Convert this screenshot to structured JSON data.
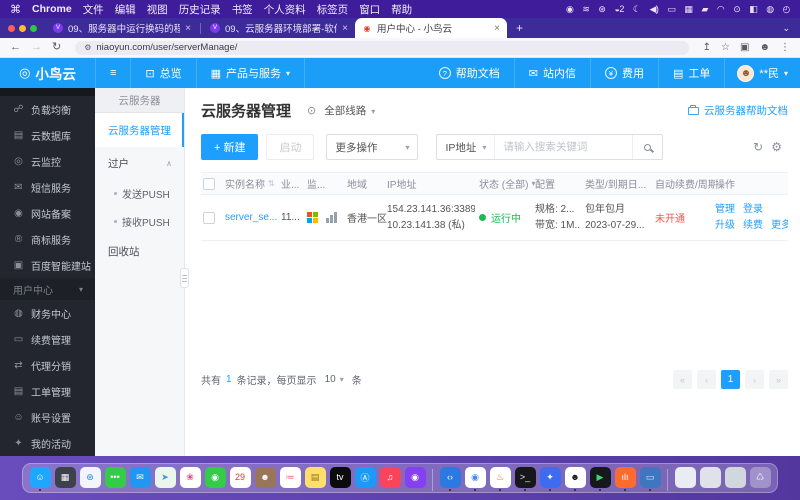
{
  "colors": {
    "accent": "#1e9fff",
    "status_green": "#1cba50",
    "alert_red": "#f0574d",
    "chrome_theme_purple": "#3f1d9a",
    "desktop_purple": "#5a3dab"
  },
  "menubar": {
    "apple": "⌘",
    "chrome": "Chrome",
    "items": [
      "文件",
      "编辑",
      "视图",
      "历史记录",
      "书签",
      "个人资料",
      "标签页",
      "窗口",
      "帮助"
    ],
    "status_icons": [
      {
        "name": "screen-record-icon",
        "glyph": "◉"
      },
      {
        "name": "audio-levels-icon",
        "glyph": "≋"
      },
      {
        "name": "compass-icon",
        "glyph": "⊛"
      },
      {
        "name": "notifications-badge-icon",
        "glyph": "◒2"
      },
      {
        "name": "dnd-moon-icon",
        "glyph": "☾"
      },
      {
        "name": "volume-icon",
        "glyph": "◀)"
      },
      {
        "name": "display-icon",
        "glyph": "▭"
      },
      {
        "name": "keyboard-icon",
        "glyph": "▦"
      },
      {
        "name": "battery-icon",
        "glyph": "▰"
      },
      {
        "name": "wifi-icon",
        "glyph": "◠"
      },
      {
        "name": "spotlight-search-icon",
        "glyph": "⊙"
      },
      {
        "name": "control-center-icon",
        "glyph": "◧"
      },
      {
        "name": "user-orb-icon",
        "glyph": "◍"
      },
      {
        "name": "clock-icon",
        "glyph": "◴"
      }
    ]
  },
  "browser": {
    "tabs": [
      {
        "title": "09、服务器中运行换码的程序-…",
        "favicon": "V"
      },
      {
        "title": "09、云服务器环境部署-软件成…",
        "favicon": "V"
      },
      {
        "title": "用户中心 - 小鸟云",
        "favicon": "◉"
      }
    ],
    "close": "×",
    "new_tab": "+",
    "chevron": "⌄",
    "back": "←",
    "forward": "→",
    "reload": "↻",
    "lock": "⚙",
    "url": "niaoyun.com/user/serverManage/",
    "share": "↥",
    "star": "☆",
    "split": "▣",
    "profile": "☻",
    "menu": "⋮"
  },
  "topnav": {
    "logo": "◎",
    "brand": "小鸟云",
    "menu_icon": "≡",
    "overview_icon": "⊡",
    "overview": "总览",
    "products_icon": "▦",
    "products": "产品与服务",
    "help_icon": "?",
    "help": "帮助文档",
    "inbox_icon": "✉",
    "inbox": "站内信",
    "billing_icon": "¥",
    "billing": "费用",
    "ticket_icon": "▤",
    "ticket": "工单",
    "avatar": "☻",
    "username": "**民"
  },
  "sidebar": {
    "items": [
      {
        "name": "sidebar-load-balancer",
        "icon": "☍",
        "label": "负载均衡"
      },
      {
        "name": "sidebar-cloud-database",
        "icon": "▤",
        "label": "云数据库"
      },
      {
        "name": "sidebar-cloud-monitor",
        "icon": "◎",
        "label": "云监控"
      },
      {
        "name": "sidebar-sms-service",
        "icon": "✉",
        "label": "短信服务"
      },
      {
        "name": "sidebar-website-filing",
        "icon": "◉",
        "label": "网站备案"
      },
      {
        "name": "sidebar-trademark-service",
        "icon": "®",
        "label": "商标服务"
      },
      {
        "name": "sidebar-baidu-site-builder",
        "icon": "▣",
        "label": "百度智能建站"
      }
    ],
    "section": {
      "label": "用户中心"
    },
    "items2": [
      {
        "name": "sidebar-finance-center",
        "icon": "◍",
        "label": "财务中心"
      },
      {
        "name": "sidebar-renewal-management",
        "icon": "▭",
        "label": "续费管理"
      },
      {
        "name": "sidebar-agent-distribution",
        "icon": "⇄",
        "label": "代理分销"
      },
      {
        "name": "sidebar-ticket-management",
        "icon": "▤",
        "label": "工单管理"
      },
      {
        "name": "sidebar-account-settings",
        "icon": "☺",
        "label": "账号设置"
      },
      {
        "name": "sidebar-my-activities",
        "icon": "✦",
        "label": "我的活动"
      }
    ]
  },
  "subsidebar": {
    "header": "云服务器",
    "active": "云服务器管理",
    "group": "过户",
    "collapse": "∧",
    "subs": [
      {
        "name": "subnav-send-push",
        "label": "发送PUSH"
      },
      {
        "name": "subnav-receive-push",
        "label": "接收PUSH"
      }
    ],
    "recycle": "回收站"
  },
  "main": {
    "title": "云服务器管理",
    "pin": "⊙",
    "line_filter": "全部线路",
    "help_link": "云服务器帮助文档",
    "toolbar": {
      "create": "+ 新建",
      "start": "启动",
      "more": "更多操作",
      "ip": "IP地址",
      "search_placeholder": "请输入搜索关键词",
      "refresh": "↻",
      "settings": "⚙"
    },
    "table": {
      "headers": [
        "实例名称",
        "业...",
        "监...",
        "地域",
        "IP地址",
        "状态 (全部)",
        "配置",
        "类型/到期日...",
        "自动续费/周期",
        "操作"
      ],
      "row": {
        "name": "server_se...",
        "biz": "11...",
        "region": "香港一区",
        "ip_line1": "154.23.141.36:3389 (...",
        "ip_line2": "10.23.141.38 (私)",
        "status": "运行中",
        "spec": "规格: 2...",
        "bandwidth": "带宽: 1M...",
        "billing_type": "包年包月",
        "expire": "2023-07-29...",
        "auto_renew": "未开通",
        "ops": [
          "管理",
          "登录",
          "升级",
          "续费",
          "更多"
        ]
      }
    },
    "footer": {
      "total_prefix": "共有",
      "total_num": "1",
      "total_mid": "条记录，每页显示",
      "page_size": "10",
      "unit": "条",
      "pager": {
        "first": "«",
        "prev": "‹",
        "page": "1",
        "next": "›",
        "last": "»"
      }
    }
  },
  "dock": {
    "left": [
      {
        "name": "dock-finder",
        "glyph": "☺",
        "bg": "#1ea7ff",
        "fg": "#ffffff",
        "dot": "1"
      },
      {
        "name": "dock-launchpad",
        "glyph": "▦",
        "bg": "#3c414c",
        "fg": "#ffffff",
        "dot": "0"
      },
      {
        "name": "dock-safari",
        "glyph": "⊛",
        "bg": "#f2f6fb",
        "fg": "#2f7fe0",
        "dot": "0"
      },
      {
        "name": "dock-messages",
        "glyph": "•••",
        "bg": "#34cb49",
        "fg": "#ffffff",
        "dot": "0"
      },
      {
        "name": "dock-mail",
        "glyph": "✉",
        "bg": "#2196f3",
        "fg": "#ffffff",
        "dot": "0"
      },
      {
        "name": "dock-maps",
        "glyph": "➤",
        "bg": "#eaf6ec",
        "fg": "#4a90d9",
        "dot": "0"
      },
      {
        "name": "dock-photos",
        "glyph": "❀",
        "bg": "#ffffff",
        "fg": "#e0477f",
        "dot": "0"
      },
      {
        "name": "dock-facetime",
        "glyph": "◉",
        "bg": "#34cb49",
        "fg": "#ffffff",
        "dot": "0"
      },
      {
        "name": "dock-calendar",
        "glyph": "29",
        "bg": "#ffffff",
        "fg": "#e03b30",
        "dot": "0"
      },
      {
        "name": "dock-contacts",
        "glyph": "☻",
        "bg": "#99765a",
        "fg": "#ffffff",
        "dot": "0"
      },
      {
        "name": "dock-reminders",
        "glyph": "≔",
        "bg": "#ffffff",
        "fg": "#f05454",
        "dot": "0"
      },
      {
        "name": "dock-notes",
        "glyph": "▤",
        "bg": "#ffdf6b",
        "fg": "#8a6d1a",
        "dot": "0"
      },
      {
        "name": "dock-apple-tv",
        "glyph": "tv",
        "bg": "#0b0b0d",
        "fg": "#ffffff",
        "dot": "0"
      },
      {
        "name": "dock-app-store",
        "glyph": "Ⓐ",
        "bg": "#1b9af7",
        "fg": "#ffffff",
        "dot": "0"
      },
      {
        "name": "dock-music",
        "glyph": "♫",
        "bg": "#fb445c",
        "fg": "#ffffff",
        "dot": "0"
      },
      {
        "name": "dock-podcasts",
        "glyph": "◉",
        "bg": "#8440f1",
        "fg": "#ffffff",
        "dot": "0"
      }
    ],
    "right": [
      {
        "name": "dock-vscode",
        "glyph": "‹›",
        "bg": "#2a7ae2",
        "fg": "#ffffff",
        "dot": "1"
      },
      {
        "name": "dock-chrome",
        "glyph": "◉",
        "bg": "#ffffff",
        "fg": "#4285f4",
        "dot": "1"
      },
      {
        "name": "dock-remote-desktop-app",
        "glyph": "♨",
        "bg": "#ffffff",
        "fg": "#ff5722",
        "dot": "1"
      },
      {
        "name": "dock-terminal",
        "glyph": ">_",
        "bg": "#17171b",
        "fg": "#e8e8e8",
        "dot": "1"
      },
      {
        "name": "dock-todesk",
        "glyph": "✦",
        "bg": "#3d6cf0",
        "fg": "#ffffff",
        "dot": "1"
      },
      {
        "name": "dock-qq",
        "glyph": "☻",
        "bg": "#ffffff",
        "fg": "#14161a",
        "dot": "1"
      },
      {
        "name": "dock-capcut",
        "glyph": "▶",
        "bg": "#17181c",
        "fg": "#38d678",
        "dot": "1"
      },
      {
        "name": "dock-stats-app",
        "glyph": "ılı",
        "bg": "#ff6a2e",
        "fg": "#ffffff",
        "dot": "1"
      },
      {
        "name": "dock-display-app",
        "glyph": "▭",
        "bg": "#3f76c0",
        "fg": "#d4e6ff",
        "dot": "1"
      }
    ],
    "windows": [
      {
        "name": "dock-window-thumb",
        "glyph": "",
        "bg": "#e9ecf2",
        "fg": "#999999",
        "dot": "0"
      },
      {
        "name": "dock-window-thumb",
        "glyph": "",
        "bg": "#dfe2e8",
        "fg": "#999999",
        "dot": "0"
      },
      {
        "name": "dock-window-thumb",
        "glyph": "",
        "bg": "#d2d7df",
        "fg": "#999999",
        "dot": "0"
      },
      {
        "name": "dock-trash",
        "glyph": "♺",
        "bg": "rgba(255,255,255,0.30)",
        "fg": "#f2f2f6",
        "dot": "0"
      }
    ]
  }
}
